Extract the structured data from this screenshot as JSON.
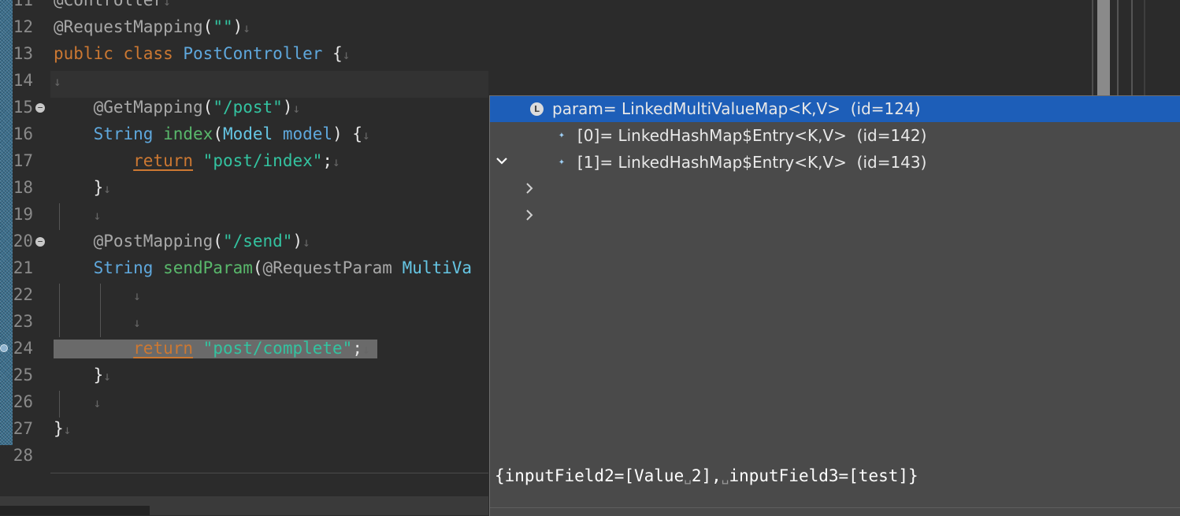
{
  "editor": {
    "line_numbers": [
      "11",
      "12",
      "13",
      "14",
      "15",
      "16",
      "17",
      "18",
      "19",
      "20",
      "21",
      "22",
      "23",
      "24",
      "25",
      "26",
      "27",
      "28"
    ],
    "whitespace_marker": "↓",
    "code": {
      "l11": "@Controller",
      "l12_ann": "@RequestMapping",
      "l12_open": "(",
      "l12_str": "\"\"",
      "l12_close": ")",
      "l13_kw1": "public",
      "l13_kw2": "class",
      "l13_cls": "PostController",
      "l13_brace": "{",
      "l15_ann": "@GetMapping",
      "l15_open": "(",
      "l15_str": "\"/post\"",
      "l15_close": ")",
      "l16_type": "String",
      "l16_fn": "index",
      "l16_open": "(",
      "l16_ptype": "Model",
      "l16_pname": "model",
      "l16_rest": ") {",
      "l17_kw": "return",
      "l17_str": "\"post/index\"",
      "l17_semi": ";",
      "l18": "}",
      "l20_ann": "@PostMapping",
      "l20_open": "(",
      "l20_str": "\"/send\"",
      "l20_close": ")",
      "l21_type": "String",
      "l21_fn": "sendParam",
      "l21_open": "(",
      "l21_ann": "@RequestParam",
      "l21_ptype": "MultiVa",
      "l24_kw": "return",
      "l24_str": "\"post/complete\"",
      "l24_semi": ";",
      "l25": "}",
      "l27": "}"
    }
  },
  "debug_popup": {
    "root": {
      "name": "param",
      "value": "LinkedMultiValueMap<K,V>",
      "id": "(id=124)",
      "icon_letter": "L"
    },
    "children": [
      {
        "index": "[0]",
        "value": "LinkedHashMap$Entry<K,V>",
        "id": "(id=142)"
      },
      {
        "index": "[1]",
        "value": "LinkedHashMap$Entry<K,V>",
        "id": "(id=143)"
      }
    ],
    "detail": {
      "part1": "{inputField2=[Value",
      "space_marker": "␣",
      "part2": "2],",
      "part3": "inputField3=[test]}"
    },
    "colors": {
      "selection": "#1d5eb8",
      "background": "#4a4a4a"
    }
  }
}
